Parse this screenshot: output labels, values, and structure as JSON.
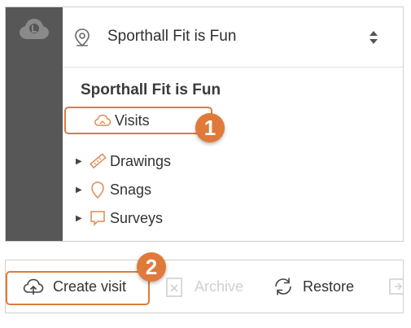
{
  "header": {
    "project_name": "Sporthall Fit is Fun"
  },
  "tree": {
    "title": "Sporthall Fit is Fun",
    "items": [
      {
        "label": "Visits",
        "icon": "cloud-icon",
        "expandable": false
      },
      {
        "label": "Drawings",
        "icon": "ruler-icon",
        "expandable": true
      },
      {
        "label": "Snags",
        "icon": "pin-icon",
        "expandable": true
      },
      {
        "label": "Surveys",
        "icon": "speech-bubble-icon",
        "expandable": true
      }
    ]
  },
  "toolbar": {
    "create_label": "Create visit",
    "archive_label": "Archive",
    "restore_label": "Restore"
  },
  "callouts": {
    "one": "1",
    "two": "2"
  },
  "colors": {
    "accent": "#e07a3a",
    "rail": "#575757",
    "icon_outline": "#e08a55",
    "disabled": "#d0d0d0"
  }
}
